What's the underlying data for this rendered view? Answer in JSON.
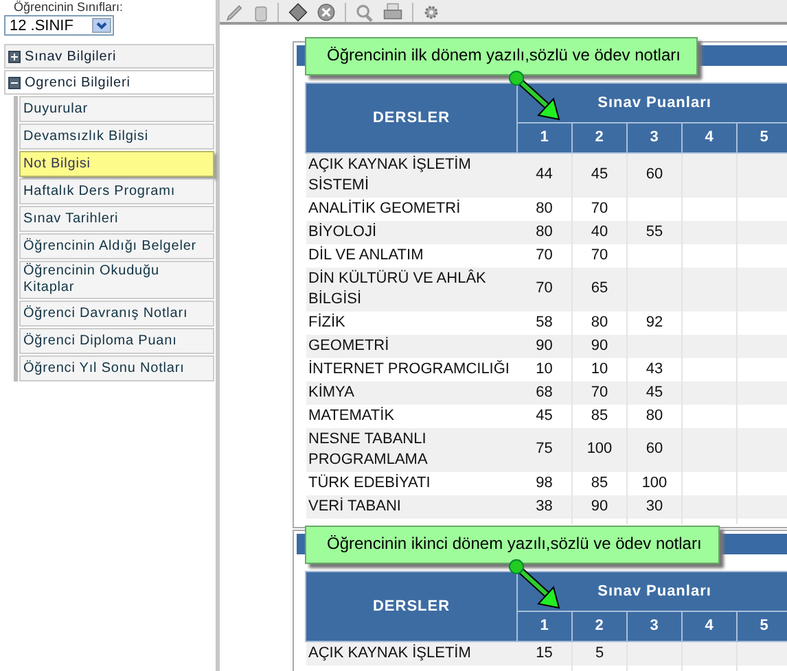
{
  "class_select": {
    "label": "Öğrencinin Sınıfları:",
    "value": "12 .SINIF"
  },
  "sidebar": {
    "items": [
      {
        "label": "Sınav Bilgileri",
        "expanded": false
      },
      {
        "label": "Ogrenci Bilgileri",
        "expanded": true,
        "children": [
          {
            "label": "Duyurular",
            "selected": false
          },
          {
            "label": "Devamsızlık Bilgisi",
            "selected": false
          },
          {
            "label": "Not Bilgisi",
            "selected": true
          },
          {
            "label": "Haftalık Ders Programı",
            "selected": false
          },
          {
            "label": "Sınav Tarihleri",
            "selected": false
          },
          {
            "label": "Öğrencinin Aldığı Belgeler",
            "selected": false
          },
          {
            "label": "Öğrencinin Okuduğu Kitaplar",
            "selected": false
          },
          {
            "label": "Öğrenci Davranış Notları",
            "selected": false
          },
          {
            "label": "Öğrenci Diploma Puanı",
            "selected": false
          },
          {
            "label": "Öğrenci Yıl Sonu Notları",
            "selected": false
          }
        ]
      }
    ]
  },
  "terms": [
    {
      "callout": "Öğrencinin ilk dönem yazılı,sözlü ve ödev notları",
      "table": {
        "course_header": "DERSLER",
        "group_header": "Sınav Puanları",
        "score_columns": [
          "1",
          "2",
          "3",
          "4",
          "5"
        ],
        "rows": [
          {
            "course": "AÇIK KAYNAK İŞLETİM SİSTEMİ",
            "scores": [
              "44",
              "45",
              "60"
            ]
          },
          {
            "course": "ANALİTİK GEOMETRİ",
            "scores": [
              "80",
              "70"
            ]
          },
          {
            "course": "BİYOLOJİ",
            "scores": [
              "80",
              "40",
              "55"
            ]
          },
          {
            "course": "DİL VE ANLATIM",
            "scores": [
              "70",
              "70"
            ]
          },
          {
            "course": "DİN KÜLTÜRÜ VE AHLÂK BİLGİSİ",
            "scores": [
              "70",
              "65"
            ]
          },
          {
            "course": "FİZİK",
            "scores": [
              "58",
              "80",
              "92"
            ]
          },
          {
            "course": "GEOMETRİ",
            "scores": [
              "90",
              "90"
            ]
          },
          {
            "course": "İNTERNET PROGRAMCILIĞI",
            "scores": [
              "10",
              "10",
              "43"
            ]
          },
          {
            "course": "KİMYA",
            "scores": [
              "68",
              "70",
              "45"
            ]
          },
          {
            "course": "MATEMATİK",
            "scores": [
              "45",
              "85",
              "80"
            ]
          },
          {
            "course": "NESNE TABANLI PROGRAMLAMA",
            "scores": [
              "75",
              "100",
              "60"
            ]
          },
          {
            "course": "TÜRK EDEBİYATI",
            "scores": [
              "98",
              "85",
              "100"
            ]
          },
          {
            "course": "VERİ TABANI",
            "scores": [
              "38",
              "90",
              "30"
            ]
          }
        ]
      }
    },
    {
      "callout": "Öğrencinin ikinci dönem yazılı,sözlü ve ödev notları",
      "table": {
        "course_header": "DERSLER",
        "group_header": "Sınav Puanları",
        "score_columns": [
          "1",
          "2",
          "3",
          "4",
          "5"
        ],
        "rows": [
          {
            "course": "AÇIK KAYNAK İŞLETİM",
            "scores": [
              "15",
              "5"
            ]
          }
        ]
      }
    }
  ]
}
